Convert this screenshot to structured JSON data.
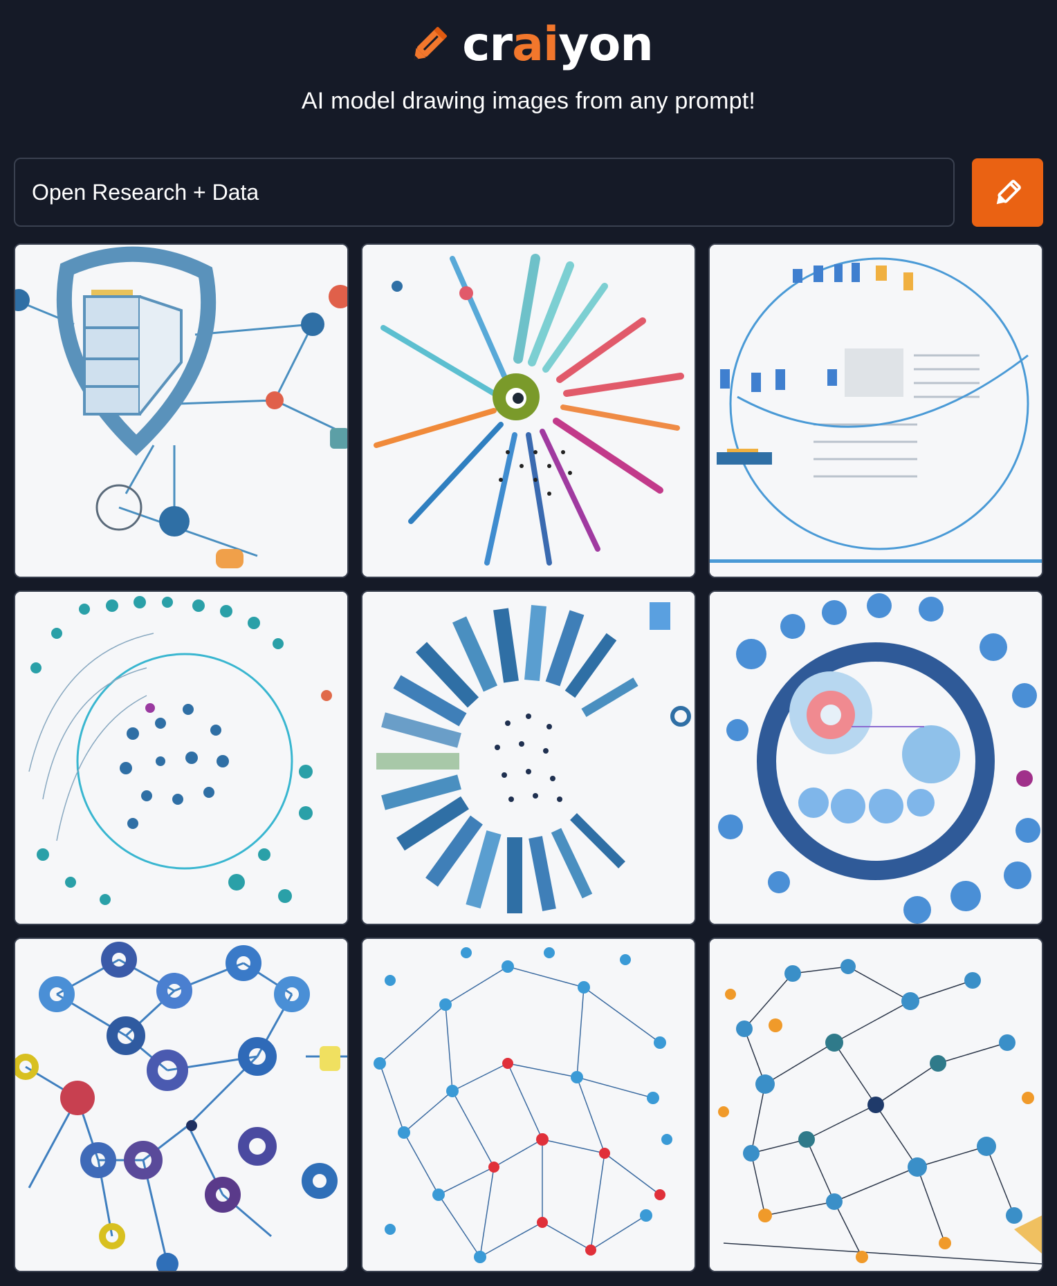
{
  "brand": {
    "name_part1": "cr",
    "name_part2": "ai",
    "name_part3": "yon",
    "logo_icon": "pencil-icon",
    "colors": {
      "accent": "#f2772c",
      "button": "#ea6213",
      "background": "#151a27"
    }
  },
  "tagline": "AI model drawing images from any prompt!",
  "prompt": {
    "value": "Open Research + Data",
    "submit_icon": "pencil-icon"
  },
  "results": {
    "images": [
      {
        "motif": "shield-network"
      },
      {
        "motif": "radial-burst"
      },
      {
        "motif": "circle-dashboard"
      },
      {
        "motif": "concentric-dots"
      },
      {
        "motif": "radial-bars"
      },
      {
        "motif": "ring-nodes"
      },
      {
        "motif": "ring-network"
      },
      {
        "motif": "mesh-network"
      },
      {
        "motif": "node-graph"
      }
    ]
  }
}
